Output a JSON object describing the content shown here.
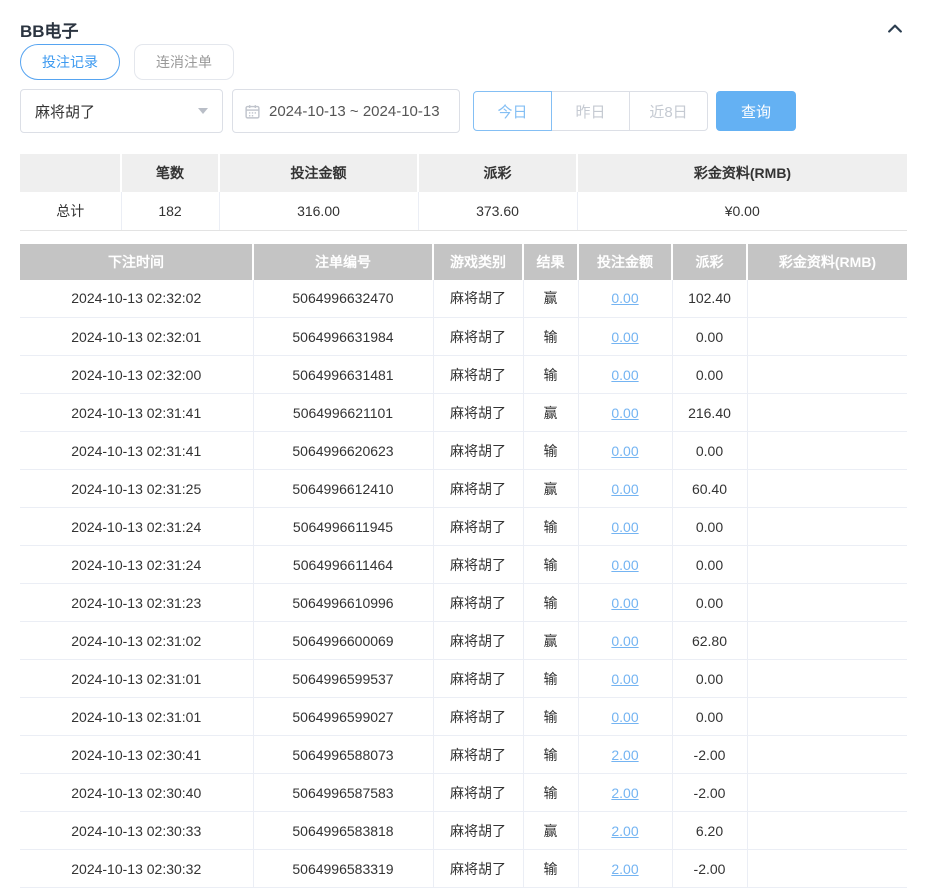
{
  "header": {
    "title": "BB电子",
    "collapse_icon": "chevron-up"
  },
  "tabs": [
    {
      "label": "投注记录",
      "active": true
    },
    {
      "label": "连消注单",
      "active": false
    }
  ],
  "filters": {
    "game_select": {
      "value": "麻将胡了"
    },
    "date_range": {
      "value": "2024-10-13 ~ 2024-10-13"
    },
    "quick_buttons": [
      {
        "label": "今日",
        "active": true
      },
      {
        "label": "昨日",
        "active": false
      },
      {
        "label": "近8日",
        "active": false
      }
    ],
    "search_label": "查询"
  },
  "summary": {
    "columns": [
      "",
      "笔数",
      "投注金额",
      "派彩",
      "彩金资料(RMB)"
    ],
    "row": {
      "label": "总计",
      "count": "182",
      "bet_amount": "316.00",
      "payout": "373.60",
      "jackpot": "¥0.00"
    }
  },
  "table": {
    "columns": [
      "下注时间",
      "注单编号",
      "游戏类别",
      "结果",
      "投注金额",
      "派彩",
      "彩金资料(RMB)"
    ],
    "rows": [
      {
        "time": "2024-10-13 02:32:02",
        "id": "5064996632470",
        "game": "麻将胡了",
        "result": "赢",
        "bet": "0.00",
        "payout": "102.40",
        "jackpot": ""
      },
      {
        "time": "2024-10-13 02:32:01",
        "id": "5064996631984",
        "game": "麻将胡了",
        "result": "输",
        "bet": "0.00",
        "payout": "0.00",
        "jackpot": ""
      },
      {
        "time": "2024-10-13 02:32:00",
        "id": "5064996631481",
        "game": "麻将胡了",
        "result": "输",
        "bet": "0.00",
        "payout": "0.00",
        "jackpot": ""
      },
      {
        "time": "2024-10-13 02:31:41",
        "id": "5064996621101",
        "game": "麻将胡了",
        "result": "赢",
        "bet": "0.00",
        "payout": "216.40",
        "jackpot": ""
      },
      {
        "time": "2024-10-13 02:31:41",
        "id": "5064996620623",
        "game": "麻将胡了",
        "result": "输",
        "bet": "0.00",
        "payout": "0.00",
        "jackpot": ""
      },
      {
        "time": "2024-10-13 02:31:25",
        "id": "5064996612410",
        "game": "麻将胡了",
        "result": "赢",
        "bet": "0.00",
        "payout": "60.40",
        "jackpot": ""
      },
      {
        "time": "2024-10-13 02:31:24",
        "id": "5064996611945",
        "game": "麻将胡了",
        "result": "输",
        "bet": "0.00",
        "payout": "0.00",
        "jackpot": ""
      },
      {
        "time": "2024-10-13 02:31:24",
        "id": "5064996611464",
        "game": "麻将胡了",
        "result": "输",
        "bet": "0.00",
        "payout": "0.00",
        "jackpot": ""
      },
      {
        "time": "2024-10-13 02:31:23",
        "id": "5064996610996",
        "game": "麻将胡了",
        "result": "输",
        "bet": "0.00",
        "payout": "0.00",
        "jackpot": ""
      },
      {
        "time": "2024-10-13 02:31:02",
        "id": "5064996600069",
        "game": "麻将胡了",
        "result": "赢",
        "bet": "0.00",
        "payout": "62.80",
        "jackpot": ""
      },
      {
        "time": "2024-10-13 02:31:01",
        "id": "5064996599537",
        "game": "麻将胡了",
        "result": "输",
        "bet": "0.00",
        "payout": "0.00",
        "jackpot": ""
      },
      {
        "time": "2024-10-13 02:31:01",
        "id": "5064996599027",
        "game": "麻将胡了",
        "result": "输",
        "bet": "0.00",
        "payout": "0.00",
        "jackpot": ""
      },
      {
        "time": "2024-10-13 02:30:41",
        "id": "5064996588073",
        "game": "麻将胡了",
        "result": "输",
        "bet": "2.00",
        "payout": "-2.00",
        "jackpot": ""
      },
      {
        "time": "2024-10-13 02:30:40",
        "id": "5064996587583",
        "game": "麻将胡了",
        "result": "输",
        "bet": "2.00",
        "payout": "-2.00",
        "jackpot": ""
      },
      {
        "time": "2024-10-13 02:30:33",
        "id": "5064996583818",
        "game": "麻将胡了",
        "result": "赢",
        "bet": "2.00",
        "payout": "6.20",
        "jackpot": ""
      },
      {
        "time": "2024-10-13 02:30:32",
        "id": "5064996583319",
        "game": "麻将胡了",
        "result": "输",
        "bet": "2.00",
        "payout": "-2.00",
        "jackpot": ""
      }
    ]
  },
  "colors": {
    "accent_blue": "#3d9af0",
    "button_blue": "#64b1f3",
    "link_blue": "#74b4f2",
    "negative_red": "#e25d5d",
    "table_header_gray": "#c4c4c4",
    "summary_header_gray": "#efefef",
    "title_dark": "#2b3440"
  }
}
